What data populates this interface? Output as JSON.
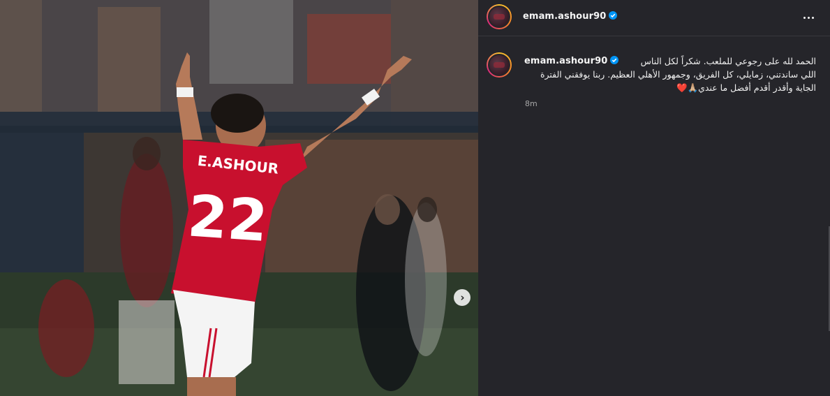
{
  "post": {
    "username": "emam.ashour90",
    "verified": true,
    "more_icon": "more-horizontal-icon",
    "next_icon": "chevron-right-icon"
  },
  "photo": {
    "jersey_name": "E.ASHOUR",
    "jersey_number": "22"
  },
  "comment": {
    "username": "emam.ashour90",
    "caption": "الحمد لله على رجوعي للملعب. شكراً لكل الناس اللي ساندتني، زمايلي، كل الفريق، وجمهور الأهلي العظيم. ربنا يوفقني الفترة الجاية وأقدر أقدم أفضل ما عندي🙏🏼❤️",
    "time": "8m"
  },
  "colors": {
    "side_background": "#25252a",
    "verified_badge": "#0095f6",
    "jersey_red": "#c8102e"
  }
}
